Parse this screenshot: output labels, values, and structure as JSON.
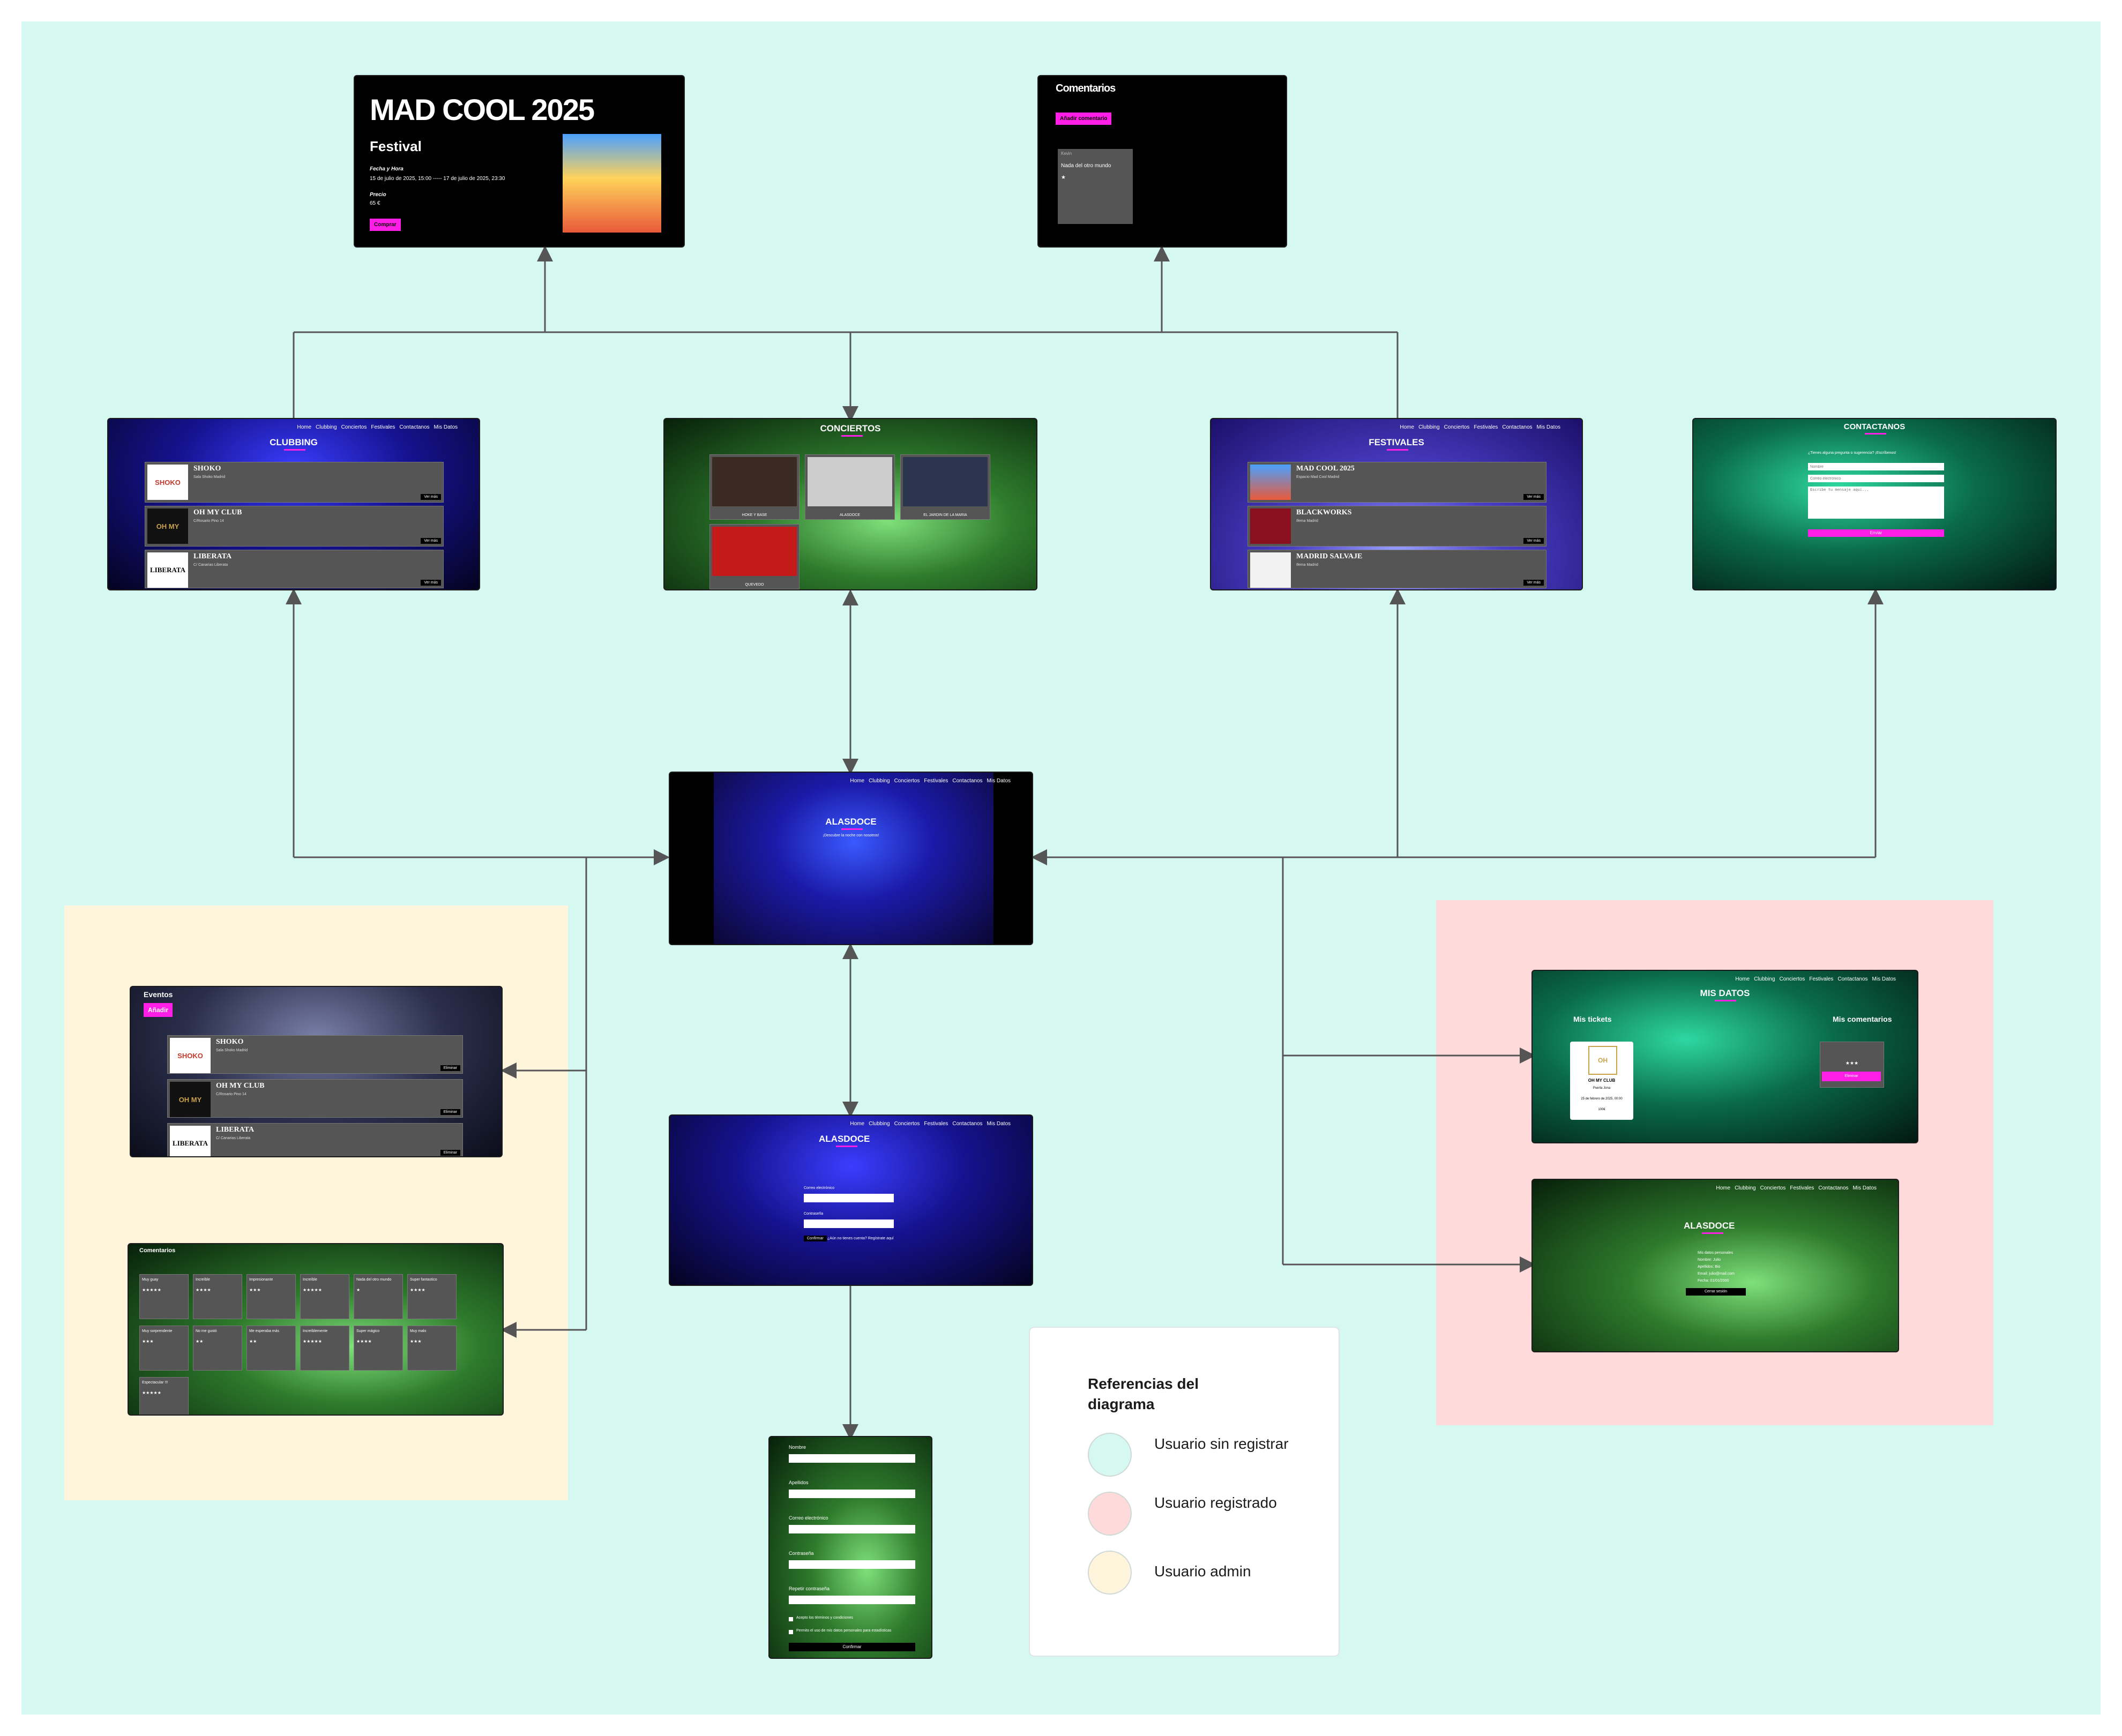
{
  "legend": {
    "title": "Referencias del diagrama",
    "items": [
      {
        "label": "Usuario sin registrar",
        "color": "#d5f8f1"
      },
      {
        "label": "Usuario registrado",
        "color": "#ffdada"
      },
      {
        "label": "Usuario admin",
        "color": "#fff4dc"
      }
    ]
  },
  "nav": {
    "home": "Home",
    "clubbing": "Clubbing",
    "conciertos": "Conciertos",
    "festivales": "Festivales",
    "contactanos": "Contactanos",
    "misdatos": "Mis Datos"
  },
  "event_detail": {
    "title": "MAD COOL 2025",
    "category": "Festival",
    "date_label": "Fecha y Hora",
    "date_value": "15 de julio de 2025, 15:00 ----- 17 de julio de 2025, 23:30",
    "price_label": "Precio",
    "price_value": "65 €",
    "buy_button": "Comprar"
  },
  "comments_page": {
    "title": "Comentarios",
    "add_button": "Añadir comentario",
    "comment_user": "Kevin",
    "comment_text": "Nada del otro mundo",
    "comment_stars": "★"
  },
  "clubbing": {
    "title": "CLUBBING",
    "items": [
      {
        "logo": "SHOKO",
        "name": "SHOKO",
        "sub": "Sala Shoko Madrid",
        "btn": "Ver más"
      },
      {
        "logo": "OH MY",
        "name": "OH MY CLUB",
        "sub": "C/Rosario Pino 14",
        "btn": "Ver más"
      },
      {
        "logo": "LIBERATA",
        "name": "LIBERATA",
        "sub": "C/ Canarias Liberata",
        "btn": "Ver más"
      }
    ]
  },
  "conciertos": {
    "title": "CONCIERTOS",
    "items": [
      "HOKE Y BASE",
      "ALASDOCE",
      "EL JARDIN DE LA MARIA",
      "QUEVEDO"
    ]
  },
  "festivales": {
    "title": "FESTIVALES",
    "items": [
      {
        "name": "MAD COOL 2025",
        "sub": "Espacio Mad Cool Madrid",
        "btn": "Ver más"
      },
      {
        "name": "BLACKWORKS",
        "sub": "Ifema Madrid",
        "btn": "Ver más"
      },
      {
        "name": "MADRID SALVAJE",
        "sub": "Ifema Madrid",
        "btn": "Ver más"
      }
    ]
  },
  "contacto": {
    "title": "CONTACTANOS",
    "intro": "¿Tienes alguna pregunta o sugerencia? ¡Escríbenos!",
    "name_ph": "Nombre",
    "email_ph": "Correo electrónico",
    "msg_ph": "Escribe tu mensaje aquí...",
    "send": "Enviar"
  },
  "home": {
    "title": "ALASDOCE",
    "subtitle": "¡Descubre la noche con nosotros!"
  },
  "login": {
    "title": "ALASDOCE",
    "email_label": "Correo electrónico",
    "pass_label": "Contraseña",
    "button": "Confirmar",
    "register_text": "¿Aún no tienes cuenta? Regístrate aquí"
  },
  "register": {
    "fields": [
      "Nombre",
      "Apellidos",
      "Correo electrónico",
      "Contraseña",
      "Repetir contraseña"
    ],
    "check1": "Acepto los términos y condiciones",
    "check2": "Permito el uso de mis datos personales para estadísticas",
    "button": "Confirmar"
  },
  "admin_events": {
    "title": "Eventos",
    "add": "Añadir",
    "items": [
      {
        "logo": "SHOKO",
        "name": "SHOKO",
        "sub": "Sala Shoko Madrid",
        "btn": "Eliminar"
      },
      {
        "logo": "OH MY",
        "name": "OH MY CLUB",
        "sub": "C/Rosario Pino 14",
        "btn": "Eliminar"
      },
      {
        "logo": "LIBERATA",
        "name": "LIBERATA",
        "sub": "C/ Canarias Liberata",
        "btn": "Eliminar"
      }
    ]
  },
  "admin_comments": {
    "title": "Comentarios",
    "tiles": [
      {
        "text": "Muy guay",
        "stars": "★★★★★"
      },
      {
        "text": "Increíble",
        "stars": "★★★★"
      },
      {
        "text": "Impresionante",
        "stars": "★★★"
      },
      {
        "text": "Increíble",
        "stars": "★★★★★"
      },
      {
        "text": "Nada del otro mundo",
        "stars": "★"
      },
      {
        "text": "Super fantastico",
        "stars": "★★★★"
      },
      {
        "text": "Muy sorprendente",
        "stars": "★★★"
      },
      {
        "text": "No me gustó",
        "stars": "★★"
      },
      {
        "text": "Me esperaba más",
        "stars": "★★"
      },
      {
        "text": "Increíblemente",
        "stars": "★★★★★"
      },
      {
        "text": "Super mágico",
        "stars": "★★★★"
      },
      {
        "text": "Muy malo",
        "stars": "★★★"
      },
      {
        "text": "Espectacular !!!",
        "stars": "★★★★★"
      }
    ]
  },
  "mis_datos": {
    "title": "MIS DATOS",
    "tickets_title": "Mis tickets",
    "comments_title": "Mis comentarios",
    "ticket_name": "OH MY CLUB",
    "ticket_place": "Puerta Jona",
    "ticket_date": "25 de febrero de 2025, 00:00",
    "ticket_price": "100€",
    "comment_stars": "★★★",
    "comment_btn": "Eliminar"
  },
  "perfil": {
    "title": "ALASDOCE",
    "lines": [
      "Mis datos personales",
      "Nombre: Julio",
      "Apellidos: Bio",
      "Email: julio@mail.com",
      "Fecha: 01/01/2000"
    ],
    "button": "Cerrar sesión"
  }
}
